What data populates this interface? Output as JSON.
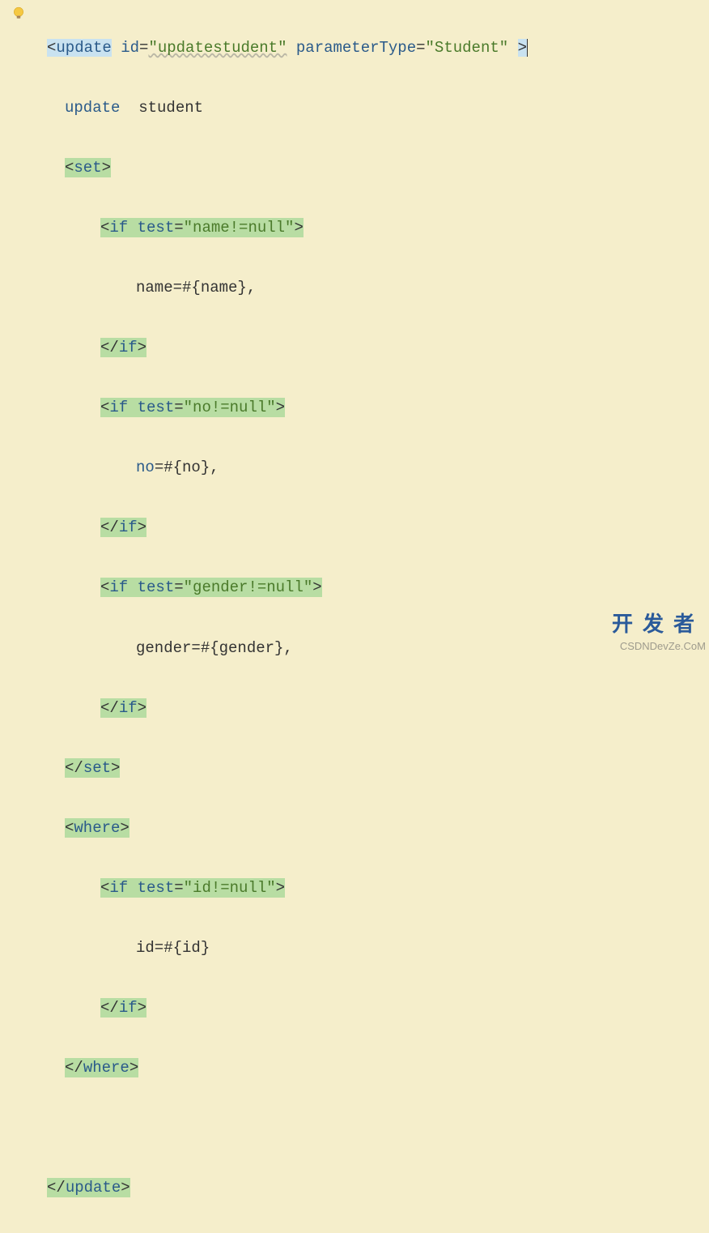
{
  "code": {
    "line1": {
      "open": "<",
      "tag": "update",
      "attr1_name": "id",
      "attr1_val": "\"updatestudent\"",
      "attr2_name": "parameterType",
      "attr2_val": "\"Student\"",
      "close": ">"
    },
    "line2": {
      "kw": "update",
      "text": "  student"
    },
    "line3": {
      "open": "<",
      "tag": "set",
      "close": ">"
    },
    "line4": {
      "open": "<",
      "tag": "if",
      "attr": "test",
      "val": "\"name!=null\"",
      "close": ">"
    },
    "line5": {
      "text": "name=#{name},"
    },
    "line6": {
      "open": "</",
      "tag": "if",
      "close": ">"
    },
    "line7": {
      "open": "<",
      "tag": "if",
      "attr": "test",
      "val": "\"no!=null\"",
      "close": ">"
    },
    "line8": {
      "kw": "no",
      "text": "=#{no},"
    },
    "line9": {
      "open": "</",
      "tag": "if",
      "close": ">"
    },
    "line10": {
      "open": "<",
      "tag": "if",
      "attr": "test",
      "val": "\"gender!=null\"",
      "close": ">"
    },
    "line11": {
      "text": "gender=#{gender},"
    },
    "line12": {
      "open": "</",
      "tag": "if",
      "close": ">"
    },
    "line13": {
      "open": "</",
      "tag": "set",
      "close": ">"
    },
    "line14": {
      "open": "<",
      "tag": "where",
      "close": ">"
    },
    "line15": {
      "open": "<",
      "tag": "if",
      "attr": "test",
      "val": "\"id!=null\"",
      "close": ">"
    },
    "line16": {
      "text": "id=#{id}"
    },
    "line17": {
      "open": "</",
      "tag": "if",
      "close": ">"
    },
    "line18": {
      "open": "</",
      "tag": "where",
      "close": ">"
    },
    "line20": {
      "open": "</",
      "tag": "update",
      "close": ">"
    }
  },
  "watermark": {
    "main": "开发者",
    "sub": "CSDNDevZe.CoM"
  },
  "icons": {
    "bulb": "intention-bulb-icon"
  }
}
